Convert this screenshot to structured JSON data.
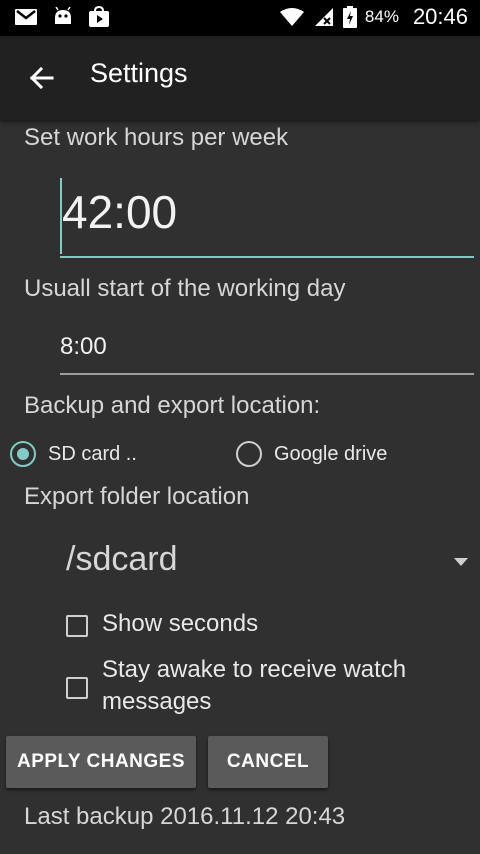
{
  "status_bar": {
    "battery_percent": "84%",
    "time": "20:46"
  },
  "app_bar": {
    "title": "Settings"
  },
  "work_hours": {
    "label": "Set work hours per week",
    "value": "42:00"
  },
  "start_day": {
    "label": "Usuall start of the working day",
    "value": "8:00"
  },
  "backup": {
    "label": "Backup and export location:",
    "options": [
      {
        "label": "SD card ..",
        "checked": true
      },
      {
        "label": "Google drive",
        "checked": false
      }
    ]
  },
  "export_folder": {
    "label": "Export folder location",
    "selected": "/sdcard"
  },
  "checkboxes": {
    "show_seconds": "Show seconds",
    "stay_awake": "Stay awake to receive watch messages"
  },
  "buttons": {
    "apply": "APPLY CHANGES",
    "cancel": "CANCEL"
  },
  "last_backup": "Last backup 2016.11.12 20:43",
  "colors": {
    "accent": "#80cbc4",
    "background": "#303030",
    "app_bar": "#212121",
    "button": "#5a5a5a"
  }
}
